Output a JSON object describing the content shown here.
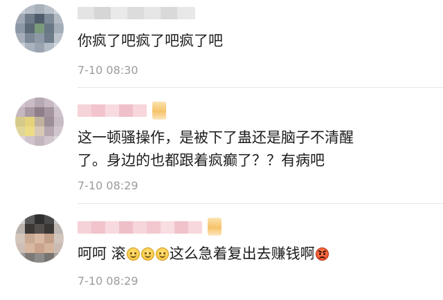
{
  "comments": [
    {
      "text_lines": [
        "你疯了吧疯了吧疯了吧"
      ],
      "timestamp": "7-10 08:30"
    },
    {
      "text_lines": [
        "这一顿骚操作，是被下了蛊还是脑子不清醒",
        "了。身边的也都跟着疯癫了？？有病吧"
      ],
      "timestamp": "7-10 08:29"
    },
    {
      "text_prefix": "呵呵 滚",
      "text_suffix": "这么急着复出去赚钱啊",
      "emoji_names": [
        "smile-emoji",
        "smile-emoji",
        "smile-emoji",
        "angry-emoji"
      ],
      "timestamp": "7-10 08:29"
    }
  ]
}
